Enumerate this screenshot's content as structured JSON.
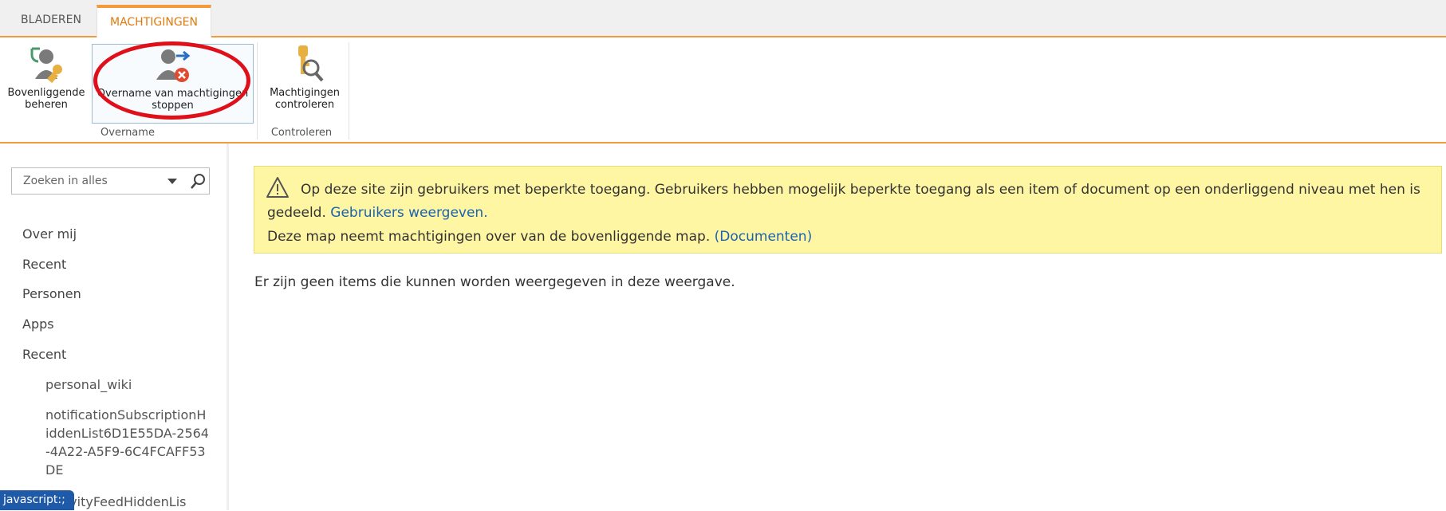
{
  "tabs": [
    {
      "label": "BLADEREN"
    },
    {
      "label": "MACHTIGINGEN"
    }
  ],
  "ribbon": {
    "buttons": {
      "manage_parent": {
        "line1": "Bovenliggende",
        "line2": "beheren"
      },
      "stop_inheritance": {
        "line1": "Overname van machtigingen",
        "line2": "stoppen"
      },
      "check_permissions": {
        "line1": "Machtigingen",
        "line2": "controleren"
      }
    },
    "groups": {
      "inheritance": "Overname",
      "check": "Controleren"
    }
  },
  "search": {
    "placeholder": "Zoeken in alles"
  },
  "nav": {
    "items": [
      "Over mij",
      "Recent",
      "Personen",
      "Apps",
      "Recent"
    ],
    "sub_items": [
      "personal_wiki",
      "notificationSubscriptionHiddenList6D1E55DA-2564-4A22-A5F9-6C4FCAFF53DE",
      "ActivityFeedHiddenLis"
    ]
  },
  "status_bar": "javascript:;",
  "alert": {
    "text1": "Op deze site zijn gebruikers met beperkte toegang. Gebruikers hebben mogelijk beperkte toegang als een item of document op een onderliggend niveau met hen is gedeeld.",
    "link1": "Gebruikers weergeven.",
    "text2": "Deze map neemt machtigingen over van de bovenliggende map.",
    "link2": "(Documenten)"
  },
  "empty_message": "Er zijn geen items die kunnen worden weergegeven in deze weergave.",
  "colors": {
    "accent": "#f29b3c",
    "active_tab_text": "#e07a10",
    "link": "#1a62b2",
    "alert_bg": "#fff6a4",
    "highlight_oval": "#e0101a",
    "status_bar": "#1e5aa8"
  }
}
